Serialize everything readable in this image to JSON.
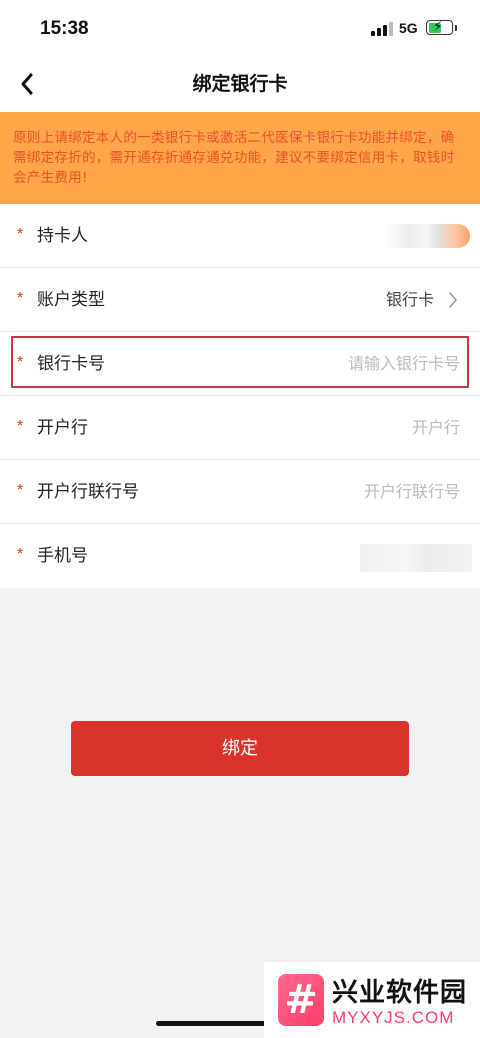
{
  "status_bar": {
    "time": "15:38",
    "network": "5G",
    "battery_level": 0.55
  },
  "nav": {
    "title": "绑定银行卡",
    "back_icon": "chevron-left-icon"
  },
  "notice": {
    "text": "原则上请绑定本人的一类银行卡或激活二代医保卡银行卡功能并绑定，确需绑定存折的，需开通存折通存通兑功能，建议不要绑定信用卡，取钱时会产生费用!"
  },
  "form": {
    "required_mark": "*",
    "rows": [
      {
        "label": "持卡人",
        "value": "",
        "placeholder": ""
      },
      {
        "label": "账户类型",
        "value": "银行卡",
        "placeholder": ""
      },
      {
        "label": "银行卡号",
        "value": "",
        "placeholder": "请输入银行卡号"
      },
      {
        "label": "开户行",
        "value": "",
        "placeholder": "开户行"
      },
      {
        "label": "开户行联行号",
        "value": "",
        "placeholder": "开户行联行号"
      },
      {
        "label": "手机号",
        "value": "",
        "placeholder": ""
      }
    ]
  },
  "bind_button": {
    "label": "绑定"
  },
  "watermark": {
    "name": "兴业软件园",
    "url": "MYXYJS.COM"
  },
  "colors": {
    "accent": "#d9342b",
    "notice_bg": "#ffa54a",
    "notice_text": "#e8542a",
    "highlight": "#c23a3f"
  }
}
